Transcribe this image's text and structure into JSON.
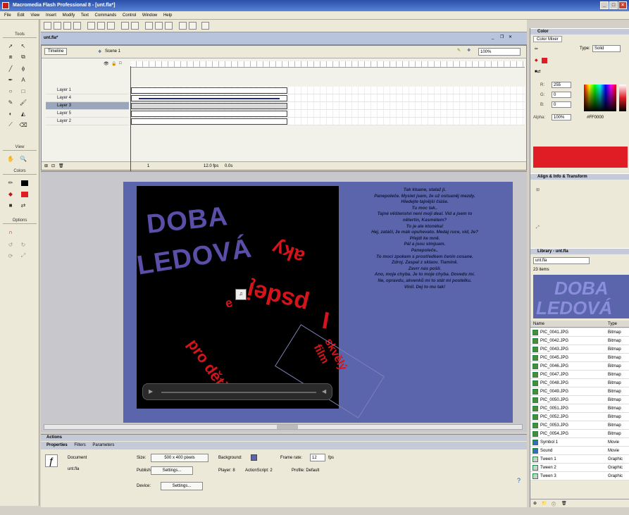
{
  "window": {
    "title": "Macromedia Flash Professional 8 - [unt.fla*]"
  },
  "menu": [
    "File",
    "Edit",
    "View",
    "Insert",
    "Modify",
    "Text",
    "Commands",
    "Control",
    "Window",
    "Help"
  ],
  "tools": {
    "label_tools": "Tools",
    "label_view": "View",
    "label_colors": "Colors",
    "label_options": "Options"
  },
  "timeline": {
    "doc_tab": "unt.fla*",
    "timeline_btn": "Timeline",
    "scene": "Scene 1",
    "zoom": "100%",
    "layers": [
      "Layer 1",
      "Layer 4",
      "Layer 3",
      "Layer 5",
      "Layer 2"
    ],
    "status_fps": "12.0 fps",
    "status_time": "0.0s",
    "status_frame": "1"
  },
  "stage": {
    "title_line1": "DOBA",
    "title_line2": "LEDOVÁ",
    "red_words": [
      "aky",
      "psdeį",
      "e",
      "I",
      "pro děti",
      "skvělý film"
    ],
    "story": [
      "Tak kluane, stalaž ji.",
      "Panepoleče. Myslet jsem, že už ostuaněj mezdy.",
      "Hledejte tajnější čiáše.",
      "Tu moc tak..",
      "Tajné věštenství neni moji deal. Vid a jsem to",
      "nětertin, Kasmétem?",
      "To je ale ktonéka!",
      "Hej, zatáčí, že mák opuhevato. Medaj ruce, vid, že?",
      "Přejdi ke mně.",
      "Pál a jsou stmjuam.",
      "Panepoleče..",
      "To moci zpokem s prostředkem čenin cosane.",
      "Zdroj. Zaspal z sklaov. Tiamině.",
      "Zavrr nás pošli.",
      "Ano, moje chyba. Je to moje chyba. Dovedu mí.",
      "Ne, opravdu, akvenků mí to stát mi postelku.",
      "Vinil. Dej to mu tak!"
    ]
  },
  "properties": {
    "panel_title": "Actions",
    "tabs": [
      "Properties",
      "Filters",
      "Parameters"
    ],
    "doc_label": "Document",
    "doc_name": "unt.fla",
    "size_label": "Size:",
    "size_value": "500 x 400 pixels",
    "bg_label": "Background:",
    "fps_label": "Frame rate:",
    "fps_value": "12",
    "fps_unit": "fps",
    "publish_label": "Publish:",
    "settings_btn": "Settings...",
    "player_label": "Player: 8",
    "as_label": "ActionScript: 2",
    "profile_label": "Profile: Default",
    "device_label": "Device:",
    "device_btn": "Settings..."
  },
  "right": {
    "color_panel": "Color",
    "color_tab": "Color Mixer",
    "type_label": "Type:",
    "type_value": "Solid",
    "r": "255",
    "g": "0",
    "b": "0",
    "alpha": "100%",
    "hex": "#FF0000",
    "align_panel": "Align & Info & Transform",
    "library_panel": "Library - unt.fla",
    "library_doc": "unt.fla",
    "library_count": "23 items",
    "preview_line1": "DOBA",
    "preview_line2": "LEDOVÁ",
    "col_name": "Name",
    "col_type": "Type",
    "items": [
      {
        "name": "PIC_0041.JPG",
        "type": "Bitmap"
      },
      {
        "name": "PIC_0042.JPG",
        "type": "Bitmap"
      },
      {
        "name": "PIC_0043.JPG",
        "type": "Bitmap"
      },
      {
        "name": "PIC_0045.JPG",
        "type": "Bitmap"
      },
      {
        "name": "PIC_0046.JPG",
        "type": "Bitmap"
      },
      {
        "name": "PIC_0047.JPG",
        "type": "Bitmap"
      },
      {
        "name": "PIC_0048.JPG",
        "type": "Bitmap"
      },
      {
        "name": "PIC_0049.JPG",
        "type": "Bitmap"
      },
      {
        "name": "PIC_0050.JPG",
        "type": "Bitmap"
      },
      {
        "name": "PIC_0051.JPG",
        "type": "Bitmap"
      },
      {
        "name": "PIC_0052.JPG",
        "type": "Bitmap"
      },
      {
        "name": "PIC_0053.JPG",
        "type": "Bitmap"
      },
      {
        "name": "PIC_0054.JPG",
        "type": "Bitmap"
      },
      {
        "name": "Symbol 1",
        "type": "Movie"
      },
      {
        "name": "Sound",
        "type": "Movie"
      },
      {
        "name": "Tween 1",
        "type": "Graphic"
      },
      {
        "name": "Tween 2",
        "type": "Graphic"
      },
      {
        "name": "Tween 3",
        "type": "Graphic"
      }
    ]
  },
  "colors": {
    "accent_red": "#e01c24",
    "stage_blue": "#5b65ac",
    "title_purple": "#5a4fa8"
  }
}
